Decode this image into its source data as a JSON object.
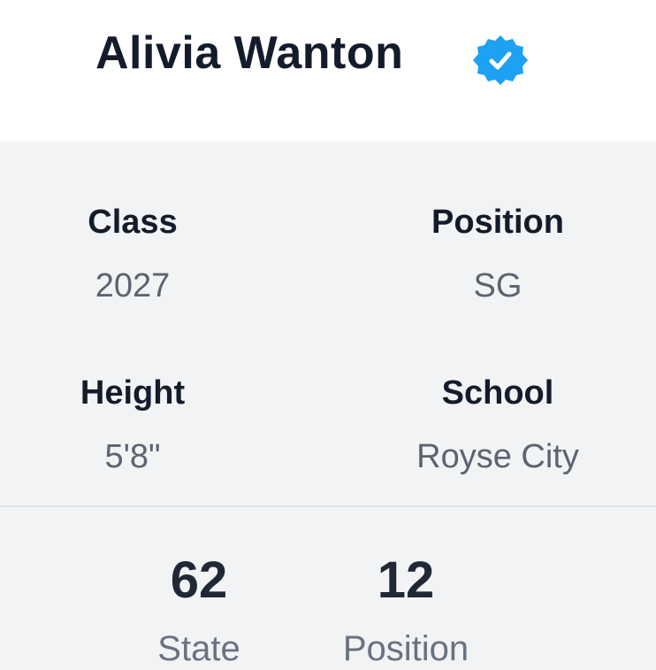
{
  "profile": {
    "name": "Alivia Wanton",
    "verified_icon": "verified-badge-icon",
    "verified_color": "#1da1f2"
  },
  "details": {
    "class": {
      "label": "Class",
      "value": "2027"
    },
    "position": {
      "label": "Position",
      "value": "SG"
    },
    "height": {
      "label": "Height",
      "value": "5'8\""
    },
    "school": {
      "label": "School",
      "value": "Royse City"
    }
  },
  "ranks": {
    "state": {
      "value": "62",
      "label": "State"
    },
    "position": {
      "value": "12",
      "label": "Position"
    }
  }
}
